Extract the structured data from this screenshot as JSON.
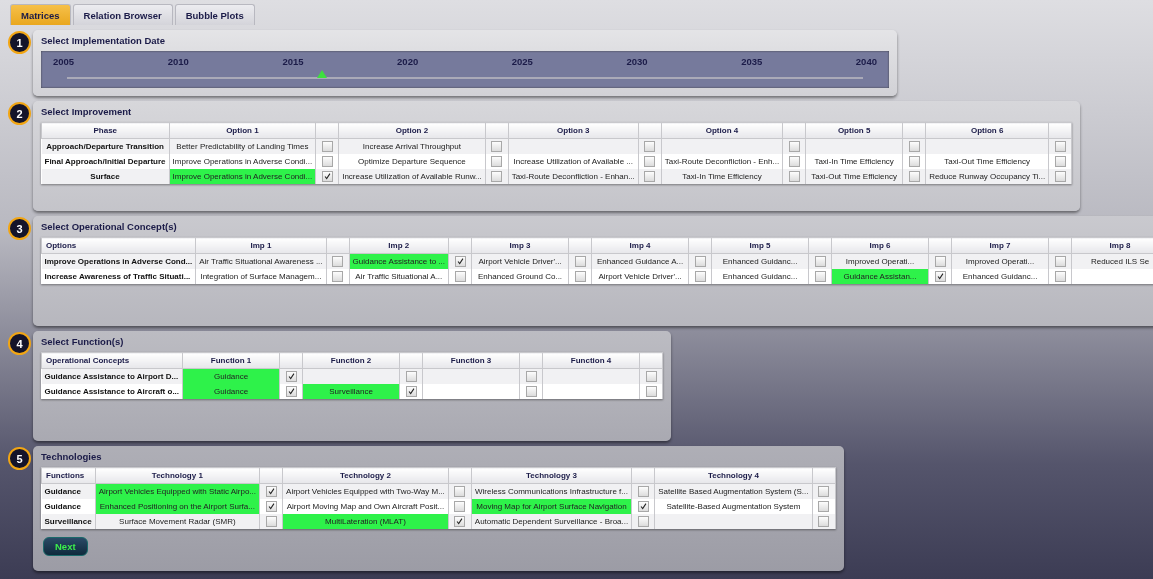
{
  "tabs": [
    {
      "label": "Matrices",
      "selected": true
    },
    {
      "label": "Relation Browser",
      "selected": false
    },
    {
      "label": "Bubble Plots",
      "selected": false
    }
  ],
  "sections": [
    {
      "kind": "slider",
      "number": "1",
      "title": "Select Implementation Date",
      "years": [
        "2005",
        "2010",
        "2015",
        "2020",
        "2025",
        "2030",
        "2035",
        "2040"
      ],
      "level": 0.32
    },
    {
      "kind": "matrix",
      "number": "2",
      "title": "Select Improvement",
      "table": {
        "corner": "Phase",
        "columns": [
          "Option 1",
          "Option 2",
          "Option 3",
          "Option 4",
          "Option 5",
          "Option 6"
        ],
        "rows": [
          {
            "label": "Approach/Departure Transition",
            "cells": [
              {
                "text": "Better Predictability of Landing Times",
                "checked": false
              },
              {
                "text": "Increase Arrival Throughput",
                "checked": false
              },
              {
                "checked": false
              },
              {
                "checked": false
              },
              {
                "checked": false
              },
              {
                "checked": false
              }
            ]
          },
          {
            "label": "Final Approach/Initial Departure",
            "cells": [
              {
                "text": "Improve Operations in Adverse Condi...",
                "checked": false
              },
              {
                "text": "Optimize Departure Sequence",
                "checked": false
              },
              {
                "text": "Increase Utilization of Available ...",
                "checked": false
              },
              {
                "text": "Taxi-Route Deconfliction - Enh...",
                "checked": false
              },
              {
                "text": "Taxi-In Time Efficiency",
                "checked": false
              },
              {
                "text": "Taxi-Out Time Efficiency",
                "checked": false
              }
            ]
          },
          {
            "label": "Surface",
            "cells": [
              {
                "text": "Improve Operations in Adverse Condi...",
                "checked": true
              },
              {
                "text": "Increase Utilization of Available Runw...",
                "checked": false
              },
              {
                "text": "Taxi-Route Deconfliction - Enhan...",
                "checked": false
              },
              {
                "text": "Taxi-In Time Efficiency",
                "checked": false
              },
              {
                "text": "Taxi-Out Time Efficiency",
                "checked": false
              },
              {
                "text": "Reduce Runway Occupancy Ti...",
                "checked": false
              }
            ]
          }
        ]
      }
    },
    {
      "kind": "matrix",
      "number": "3",
      "title": "Select Operational Concept(s)",
      "table": {
        "corner": "Options",
        "columns": [
          "Imp 1",
          "Imp 2",
          "Imp 3",
          "Imp 4",
          "Imp 5",
          "Imp 6",
          "Imp 7",
          "Imp 8"
        ],
        "rows": [
          {
            "label": "Improve Operations in Adverse Cond...",
            "cells": [
              {
                "text": "Air Traffic Situational Awareness ...",
                "checked": false
              },
              {
                "text": "Guidance Assistance to ...",
                "checked": true
              },
              {
                "text": "Airport Vehicle Driver'...",
                "checked": false
              },
              {
                "text": "Enhanced Guidance A...",
                "checked": false
              },
              {
                "text": "Enhanced Guidanc...",
                "checked": false
              },
              {
                "text": "Improved Operati...",
                "checked": false
              },
              {
                "text": "Improved Operati...",
                "checked": false
              },
              {
                "text": "Reduced ILS Se"
              }
            ]
          },
          {
            "label": "Increase Awareness of Traffic Situati...",
            "cells": [
              {
                "text": "Integration of Surface Managem...",
                "checked": false
              },
              {
                "text": "Air Traffic Situational A...",
                "checked": false
              },
              {
                "text": "Enhanced Ground Co...",
                "checked": false
              },
              {
                "text": "Airport Vehicle Driver'...",
                "checked": false
              },
              {
                "text": "Enhanced Guidanc...",
                "checked": false
              },
              {
                "text": "Guidance Assistan...",
                "checked": true
              },
              {
                "text": "Enhanced Guidanc...",
                "checked": false
              },
              {}
            ]
          }
        ]
      }
    },
    {
      "kind": "matrix",
      "number": "4",
      "title": "Select Function(s)",
      "table": {
        "corner": "Operational Concepts",
        "columns": [
          "Function 1",
          "Function 2",
          "Function 3",
          "Function 4"
        ],
        "rows": [
          {
            "label": "Guidance Assistance to Airport D...",
            "cells": [
              {
                "text": "Guidance",
                "checked": true
              },
              {
                "checked": false
              },
              {
                "checked": false
              },
              {
                "checked": false
              }
            ]
          },
          {
            "label": "Guidance Assistance to Aircraft o...",
            "cells": [
              {
                "text": "Guidance",
                "checked": true
              },
              {
                "text": "Surveillance",
                "checked": true
              },
              {
                "checked": false
              },
              {
                "checked": false
              }
            ]
          }
        ]
      }
    },
    {
      "kind": "matrix",
      "number": "5",
      "title": "Technologies",
      "table": {
        "corner": "Functions",
        "columns": [
          "Technology 1",
          "Technology 2",
          "Technology 3",
          "Technology 4"
        ],
        "rows": [
          {
            "label": "Guidance",
            "cells": [
              {
                "text": "Airport Vehicles Equipped with Static Airpo...",
                "checked": true
              },
              {
                "text": "Airport Vehicles Equipped with Two-Way M...",
                "checked": false
              },
              {
                "text": "Wireless Communications Infrastructure f...",
                "checked": false
              },
              {
                "text": "Satellite Based Augmentation System (S...",
                "checked": false
              }
            ]
          },
          {
            "label": "Guidance",
            "cells": [
              {
                "text": "Enhanced Positioning on the Airport Surfa...",
                "checked": true
              },
              {
                "text": "Airport Moving Map and Own Aircraft Posit...",
                "checked": false
              },
              {
                "text": "Moving Map for Airport Surface Navigation",
                "checked": true
              },
              {
                "text": "Satellite-Based Augmentation System",
                "checked": false
              }
            ]
          },
          {
            "label": "Surveillance",
            "cells": [
              {
                "text": "Surface Movement Radar (SMR)",
                "checked": false
              },
              {
                "text": "MultiLateration (MLAT)",
                "checked": true
              },
              {
                "text": "Automatic Dependent Surveillance - Broa...",
                "checked": false
              },
              {
                "checked": false
              }
            ]
          }
        ]
      },
      "button": "Next"
    }
  ]
}
